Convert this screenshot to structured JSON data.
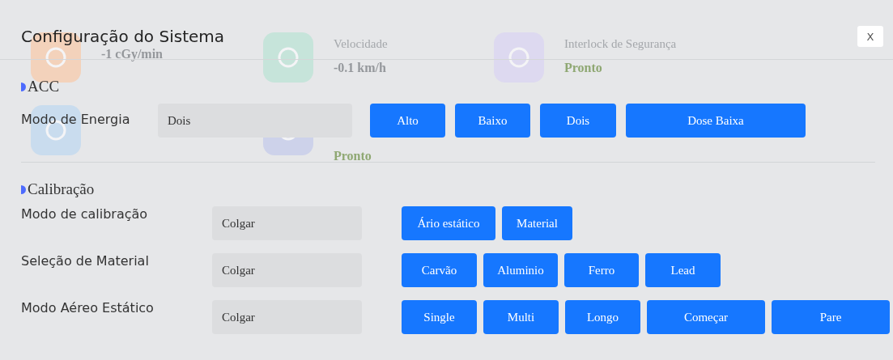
{
  "background_tiles": [
    {
      "color": "#f3d2bb",
      "kind": "metric",
      "value": "-1 cGy/min"
    },
    {
      "color": "#c6e4da",
      "kind": "metric",
      "label": "Velocidade",
      "value": "-0.1 km/h"
    },
    {
      "color": "#ddd9f0",
      "kind": "status",
      "label": "Interlock de Segurança",
      "value": "Pronto"
    },
    {
      "color": "#c9dcee"
    },
    {
      "color": "#cdd2ea",
      "kind": "status",
      "value": "Pronto"
    }
  ],
  "dialog": {
    "title": "Configuração do Sistema",
    "close": "X"
  },
  "sections": [
    {
      "title": "ACC",
      "rows": [
        {
          "label": "Modo de Energia",
          "value": "Dois",
          "buttons": [
            "Alto",
            "Baixo",
            "Dois",
            "Dose Baixa"
          ]
        }
      ]
    },
    {
      "title": "Calibração",
      "rows": [
        {
          "label": "Modo de calibração",
          "value": "Colgar",
          "buttons": [
            "Ário estático",
            "Material"
          ]
        },
        {
          "label": "Seleção de Material",
          "value": "Colgar",
          "buttons": [
            "Carvão",
            "Aluminio",
            "Ferro",
            "Lead"
          ]
        },
        {
          "label": "Modo Aéreo Estático",
          "value": "Colgar",
          "buttons": [
            "Single",
            "Multi",
            "Longo",
            "Começar",
            "Pare"
          ]
        }
      ]
    }
  ]
}
